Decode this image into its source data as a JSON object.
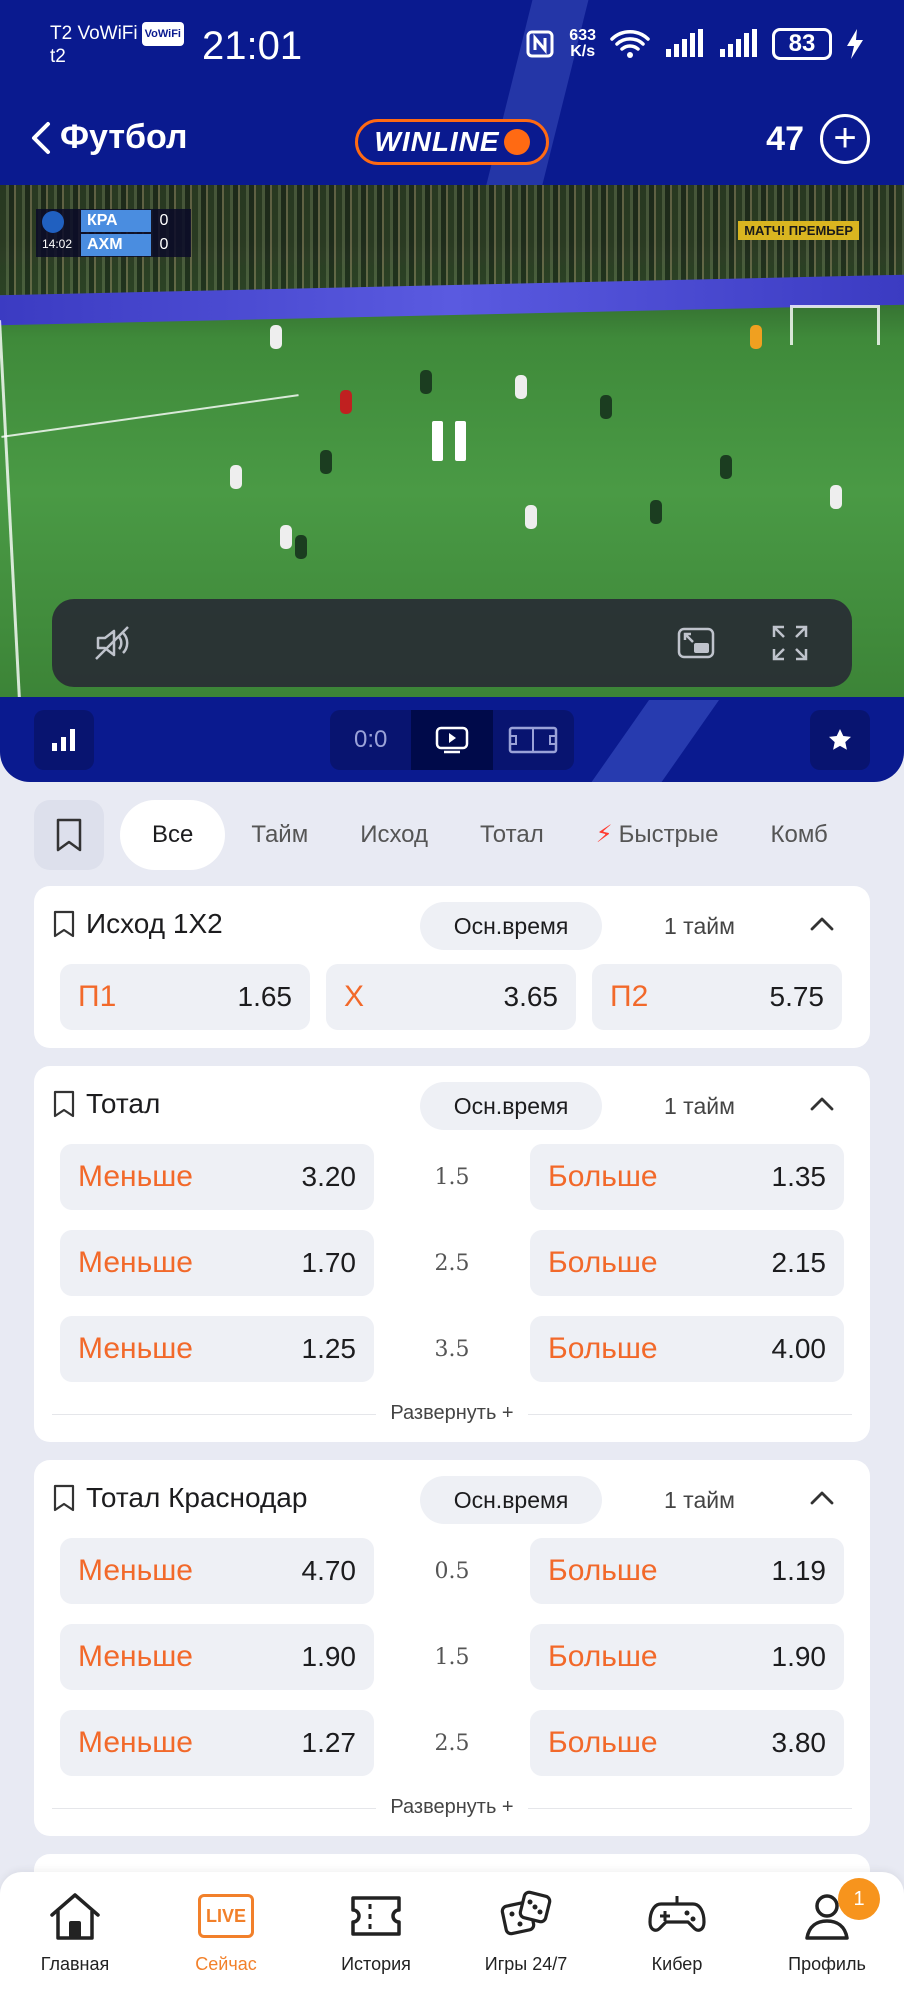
{
  "status": {
    "carrier": "T2 VoWiFi",
    "vowifi_badge": "VoWiFi",
    "carrier_sub": "t2",
    "time": "21:01",
    "net_speed_value": "633",
    "net_speed_unit": "K/s",
    "battery": "83"
  },
  "header": {
    "back_label": "Футбол",
    "logo": "WINLINE",
    "count": "47"
  },
  "video": {
    "team1": "КРА",
    "team2": "АХМ",
    "score1": "0",
    "score2": "0",
    "match_time": "14:02",
    "broadcaster": "МАТЧ! ПРЕМЬЕР"
  },
  "video_toolbar": {
    "score_tab": "0:0"
  },
  "filters": [
    "Все",
    "Тайм",
    "Исход",
    "Тотал",
    "Быстрые",
    "Комб"
  ],
  "markets": [
    {
      "title": "Исход 1X2",
      "period_pill": "Осн.время",
      "half": "1 тайм",
      "odds": [
        {
          "label": "П1",
          "value": "1.65"
        },
        {
          "label": "X",
          "value": "3.65"
        },
        {
          "label": "П2",
          "value": "5.75"
        }
      ]
    },
    {
      "title": "Тотал",
      "period_pill": "Осн.время",
      "half": "1 тайм",
      "rows": [
        {
          "left_label": "Меньше",
          "left_value": "3.20",
          "line": "1.5",
          "right_label": "Больше",
          "right_value": "1.35"
        },
        {
          "left_label": "Меньше",
          "left_value": "1.70",
          "line": "2.5",
          "right_label": "Больше",
          "right_value": "2.15"
        },
        {
          "left_label": "Меньше",
          "left_value": "1.25",
          "line": "3.5",
          "right_label": "Больше",
          "right_value": "4.00"
        }
      ],
      "expand": "Развернуть +"
    },
    {
      "title": "Тотал Краснодар",
      "period_pill": "Осн.время",
      "half": "1 тайм",
      "rows": [
        {
          "left_label": "Меньше",
          "left_value": "4.70",
          "line": "0.5",
          "right_label": "Больше",
          "right_value": "1.19"
        },
        {
          "left_label": "Меньше",
          "left_value": "1.90",
          "line": "1.5",
          "right_label": "Больше",
          "right_value": "1.90"
        },
        {
          "left_label": "Меньше",
          "left_value": "1.27",
          "line": "2.5",
          "right_label": "Больше",
          "right_value": "3.80"
        }
      ],
      "expand": "Развернуть +"
    }
  ],
  "bottom_nav": [
    {
      "label": "Главная",
      "icon": "home-icon"
    },
    {
      "label": "Сейчас",
      "icon": "live-icon",
      "icon_text": "LIVE",
      "active": true
    },
    {
      "label": "История",
      "icon": "ticket-icon"
    },
    {
      "label": "Игры 24/7",
      "icon": "dice-icon"
    },
    {
      "label": "Кибер",
      "icon": "gamepad-icon"
    },
    {
      "label": "Профиль",
      "icon": "profile-icon",
      "badge": "1"
    }
  ],
  "colors": {
    "brand_blue": "#0a1a8f",
    "accent_orange": "#f2692a",
    "live_orange": "#f2802a"
  }
}
